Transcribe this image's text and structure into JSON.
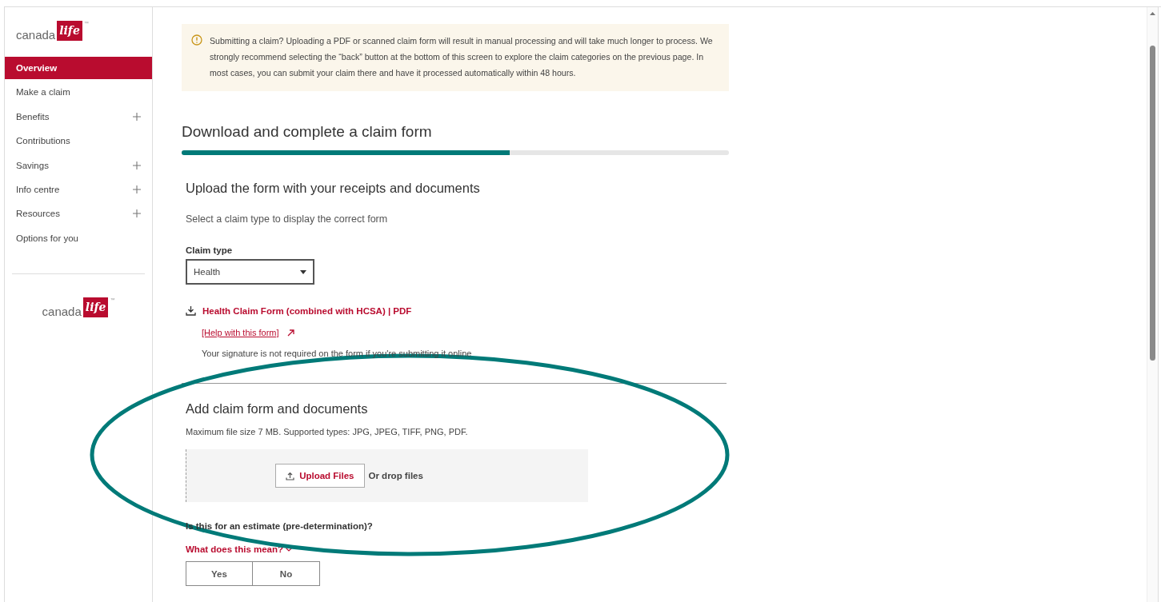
{
  "sidebar": {
    "logo": {
      "word": "canada",
      "mark": "life",
      "tm": "™"
    },
    "items": [
      {
        "label": "Overview",
        "selected": true,
        "expandable": false
      },
      {
        "label": "Make a claim",
        "selected": false,
        "expandable": false
      },
      {
        "label": "Benefits",
        "selected": false,
        "expandable": true
      },
      {
        "label": "Contributions",
        "selected": false,
        "expandable": false
      },
      {
        "label": "Savings",
        "selected": false,
        "expandable": true
      },
      {
        "label": "Info centre",
        "selected": false,
        "expandable": true
      },
      {
        "label": "Resources",
        "selected": false,
        "expandable": true
      },
      {
        "label": "Options for you",
        "selected": false,
        "expandable": false
      }
    ],
    "footer_logo": {
      "word": "canada",
      "mark": "life",
      "tm": "™"
    }
  },
  "notice": {
    "text": "Submitting a claim? Uploading a PDF or scanned claim form will result in manual processing and will take much longer to process. We strongly recommend selecting the “back” button at the bottom of this screen to explore the claim categories on the previous page. In most cases, you can submit your claim there and have it processed automatically within 48 hours."
  },
  "page_title": "Download and complete a claim form",
  "progress": {
    "level": 0.6
  },
  "upload_section": {
    "heading": "Upload the form with your receipts and documents",
    "intro": "Select a claim type to display the correct form",
    "claim_type": {
      "label": "Claim type",
      "value": "Health"
    },
    "download_link": "Health Claim Form (combined with HCSA) | PDF",
    "help_link": "[Help with this form]",
    "signature_note": "Your signature is not required on the form if you're submitting it online"
  },
  "add_section": {
    "heading": "Add claim form and documents",
    "limits": "Maximum file size 7 MB. Supported types: JPG, JPEG, TIFF, PNG, PDF.",
    "upload_button": "Upload Files",
    "drop_hint": "Or drop files",
    "question": "Is this for an estimate (pre-determination)?",
    "explain_link": "What does this mean?",
    "options": [
      {
        "label": "Yes",
        "selected": false
      },
      {
        "label": "No",
        "selected": false
      }
    ]
  }
}
